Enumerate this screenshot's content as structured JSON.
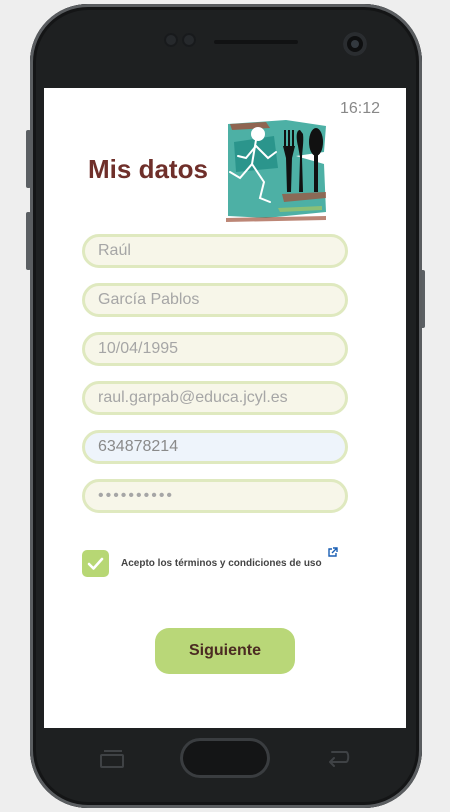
{
  "status_bar": {
    "time": "16:12"
  },
  "header": {
    "title": "Mis datos",
    "logo_icon": "runner-cutlery-logo"
  },
  "form": {
    "first_name": "Raúl",
    "last_name": "García Pablos",
    "birth_date": "10/04/1995",
    "email": "raul.garpab@educa.jcyl.es",
    "phone": "634878214",
    "password": "••••••••••"
  },
  "terms": {
    "label": "Acepto los términos y condiciones de uso",
    "checked": true
  },
  "next_button": {
    "label": "Siguiente"
  },
  "colors": {
    "title": "#6f2f2a",
    "field_border": "#dfe9bf",
    "accent": "#b9d778",
    "button_text": "#4b2b22"
  }
}
